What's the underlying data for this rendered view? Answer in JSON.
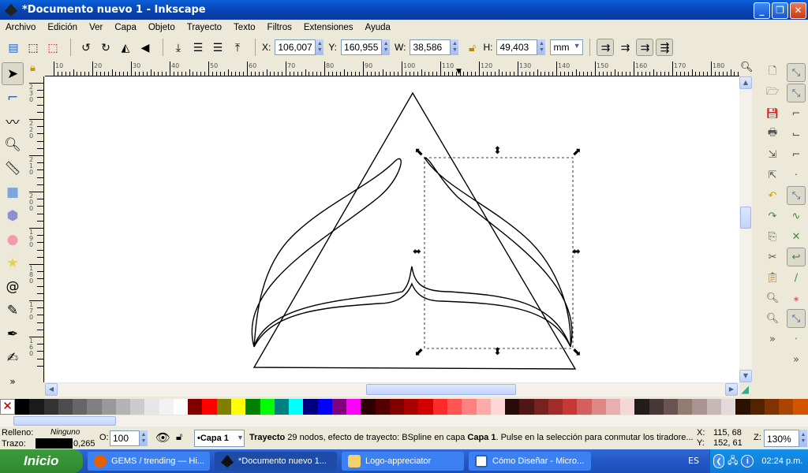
{
  "window": {
    "title": "*Documento nuevo 1 - Inkscape",
    "minimize": "_",
    "maximize": "❐",
    "close": "✕"
  },
  "menu": [
    "Archivo",
    "Edición",
    "Ver",
    "Capa",
    "Objeto",
    "Trayecto",
    "Texto",
    "Filtros",
    "Extensiones",
    "Ayuda"
  ],
  "toolbar": {
    "x_label": "X:",
    "x": "106,007",
    "y_label": "Y:",
    "y": "160,955",
    "w_label": "W:",
    "w": "38,586",
    "h_label": "H:",
    "h": "49,403",
    "unit": "mm"
  },
  "rulers": {
    "h": [
      "10",
      "20",
      "30",
      "40",
      "50",
      "60",
      "70",
      "80",
      "90",
      "100",
      "110",
      "120",
      "130",
      "140",
      "150",
      "160",
      "170",
      "180"
    ],
    "v": [
      "230",
      "220",
      "210",
      "200",
      "190",
      "180",
      "170",
      "160"
    ]
  },
  "palette": [
    "#000000",
    "#1a1a1a",
    "#333333",
    "#4d4d4d",
    "#666666",
    "#808080",
    "#999999",
    "#b3b3b3",
    "#cccccc",
    "#e6e6e6",
    "#f2f2f2",
    "#ffffff",
    "#800000",
    "#ff0000",
    "#808000",
    "#ffff00",
    "#008000",
    "#00ff00",
    "#008080",
    "#00ffff",
    "#000080",
    "#0000ff",
    "#800080",
    "#ff00ff",
    "#2b0000",
    "#550000",
    "#800000",
    "#aa0000",
    "#d40000",
    "#ff2a2a",
    "#ff5555",
    "#ff8080",
    "#ffaaaa",
    "#ffd5d5",
    "#280b0b",
    "#501616",
    "#782121",
    "#a02c2c",
    "#c83737",
    "#d35f5f",
    "#de8787",
    "#e9afaf",
    "#f4d7d7",
    "#241c1c",
    "#483737",
    "#6c5353",
    "#917c6f",
    "#ac9393",
    "#c8b7b7",
    "#e3dbdb",
    "#2b1100",
    "#552200",
    "#803300",
    "#aa4400",
    "#d45500"
  ],
  "status": {
    "fill_label": "Relleno:",
    "fill_value": "Ninguno",
    "stroke_label": "Trazo:",
    "stroke_width": "0,265",
    "opacity_label": "O:",
    "opacity": "100",
    "layer": "•Capa 1",
    "msg_bold": "Trayecto",
    "msg": " 29 nodos, efecto de trayecto: BSpline en capa ",
    "msg_layer": "Capa 1",
    "msg_tail": ". Pulse en la selección para conmutar los tiradore...",
    "cx_label": "X:",
    "cx": "115, 68",
    "cy_label": "Y:",
    "cy": "152, 61",
    "zoom_label": "Z:",
    "zoom": "130%"
  },
  "taskbar": {
    "start": "Inicio",
    "tasks": [
      "GEMS / trending — Hi...",
      "*Documento nuevo 1...",
      "Logo-appreciator",
      "Cómo Diseñar - Micro..."
    ],
    "lang": "ES",
    "clock": "02:24 p.m."
  }
}
